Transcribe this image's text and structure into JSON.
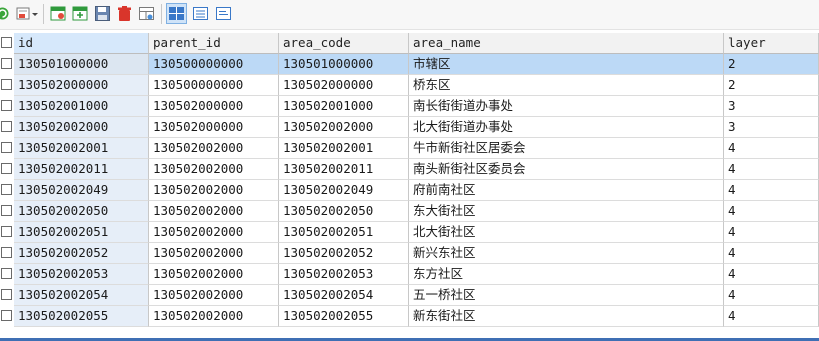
{
  "toolbar": {
    "icons": [
      "refresh-icon",
      "export-icon",
      "filter-icon",
      "new-record-icon",
      "save-icon",
      "delete-icon",
      "view-icon",
      "grid-view-icon",
      "form-view-icon",
      "text-view-icon"
    ]
  },
  "table": {
    "columns": [
      "id",
      "parent_id",
      "area_code",
      "area_name",
      "layer"
    ],
    "rows": [
      {
        "id": "130501000000",
        "parent_id": "130500000000",
        "area_code": "130501000000",
        "area_name": "市辖区",
        "layer": "2"
      },
      {
        "id": "130502000000",
        "parent_id": "130500000000",
        "area_code": "130502000000",
        "area_name": "桥东区",
        "layer": "2"
      },
      {
        "id": "130502001000",
        "parent_id": "130502000000",
        "area_code": "130502001000",
        "area_name": "南长街街道办事处",
        "layer": "3"
      },
      {
        "id": "130502002000",
        "parent_id": "130502000000",
        "area_code": "130502002000",
        "area_name": "北大街街道办事处",
        "layer": "3"
      },
      {
        "id": "130502002001",
        "parent_id": "130502002000",
        "area_code": "130502002001",
        "area_name": "牛市新街社区居委会",
        "layer": "4"
      },
      {
        "id": "130502002011",
        "parent_id": "130502002000",
        "area_code": "130502002011",
        "area_name": "南头新街社区委员会",
        "layer": "4"
      },
      {
        "id": "130502002049",
        "parent_id": "130502002000",
        "area_code": "130502002049",
        "area_name": "府前南社区",
        "layer": "4"
      },
      {
        "id": "130502002050",
        "parent_id": "130502002000",
        "area_code": "130502002050",
        "area_name": "东大街社区",
        "layer": "4"
      },
      {
        "id": "130502002051",
        "parent_id": "130502002000",
        "area_code": "130502002051",
        "area_name": "北大街社区",
        "layer": "4"
      },
      {
        "id": "130502002052",
        "parent_id": "130502002000",
        "area_code": "130502002052",
        "area_name": "新兴东社区",
        "layer": "4"
      },
      {
        "id": "130502002053",
        "parent_id": "130502002000",
        "area_code": "130502002053",
        "area_name": "东方社区",
        "layer": "4"
      },
      {
        "id": "130502002054",
        "parent_id": "130502002000",
        "area_code": "130502002054",
        "area_name": "五一桥社区",
        "layer": "4"
      },
      {
        "id": "130502002055",
        "parent_id": "130502002000",
        "area_code": "130502002055",
        "area_name": "新东街社区",
        "layer": "4"
      }
    ]
  },
  "colors": {
    "selected_row": "#bcd9f6",
    "header": "#f2f2f2",
    "accent": "#3f6fb4"
  }
}
